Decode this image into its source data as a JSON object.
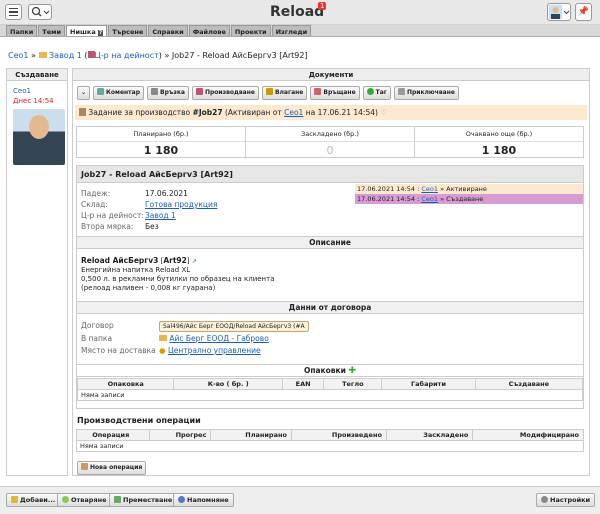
{
  "app": {
    "title": "Reload",
    "notifications": "1"
  },
  "tabs": [
    "Папки",
    "Теми",
    "Нишка",
    "Търсене",
    "Справки",
    "Файлове",
    "Проекти",
    "Изгледи"
  ],
  "tab_badge": "?",
  "breadcrumb": {
    "user": "Ceo1",
    "sep1": "»",
    "folder": "Завод 1",
    "paren_open": "(",
    "center": "Ц-р на дейност",
    "paren_close": ")",
    "sep2": "»",
    "current": "Job27 - Reload АйсБергv3 [Art92]"
  },
  "left_panel": {
    "header": "Създаване",
    "user": "Ceo1",
    "time": "Днес 14:54"
  },
  "main": {
    "header": "Документи",
    "toolbar": [
      "Коментар",
      "Връзка",
      "Производване",
      "Влагане",
      "Връщане",
      "Таг",
      "Приключване"
    ],
    "task": {
      "prefix": "Задание за производство",
      "id": "#Job27",
      "activated_by": "(Активиран от",
      "user": "Ceo1",
      "date": "на 17.06.21 14:54)"
    },
    "stats": [
      {
        "label": "Планирано (бр.)",
        "value": "1 180"
      },
      {
        "label": "Заскладено (бр.)",
        "value": "0"
      },
      {
        "label": "Очаквано още (бр.)",
        "value": "1 180"
      }
    ],
    "job_title": "Job27 - Reload АйсБергv3 [Art92]",
    "props": [
      {
        "k": "Падеж:",
        "v": "17.06.2021"
      },
      {
        "k": "Склад:",
        "v": "Готова продукция"
      },
      {
        "k": "Ц-р на дейност:",
        "v": "Завод 1"
      },
      {
        "k": "Втора мярка:",
        "v": "Без"
      }
    ],
    "log": [
      {
        "time": "17.06.2021 14:54 :",
        "user": "Ceo1",
        "action": "» Активиране"
      },
      {
        "time": "17.06.2021 14:54 :",
        "user": "Ceo1",
        "action": "» Създаване"
      }
    ],
    "description_header": "Описание",
    "product": {
      "name": "Reload АйсБергv3",
      "code": "Art92",
      "line1": "Енергийна напитка Reload XL",
      "line2": "0,500 л. в рекламни бутилки по образец на клиента",
      "line3": "(релоад наливен - 0,008 кг гуарана)"
    },
    "contract_header": "Данни от договора",
    "contract": [
      {
        "k": "Договор",
        "v": "Sal496/Айс Берг ЕООД/Reload АйсБергv3 (#A"
      },
      {
        "k": "В папка",
        "v": "Айс Берг ЕООД - Габрово"
      },
      {
        "k": "Място на доставка",
        "v": "Централно управление"
      }
    ],
    "packaging_header": "Опаковки",
    "packaging_cols": [
      "Опаковка",
      "К-во ( бр. )",
      "EAN",
      "Тегло",
      "Габарити",
      "Създаване"
    ],
    "no_records": "Няма записи",
    "ops_header": "Производствени операции",
    "ops_cols": [
      "Операция",
      "Прогрес",
      "Планирано",
      "Произведено",
      "Заскладено",
      "Модифицирано"
    ],
    "new_op": "Нова операция"
  },
  "bottom": [
    "Добави...",
    "Отваряне",
    "Преместване",
    "Напомняне",
    "Настройки"
  ]
}
